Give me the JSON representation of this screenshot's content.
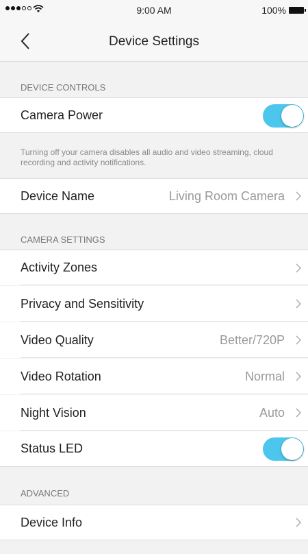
{
  "status_bar": {
    "time": "9:00 AM",
    "battery_text": "100%"
  },
  "nav": {
    "title": "Device Settings",
    "back_icon": "chevron-left-icon"
  },
  "sections": {
    "device_controls": {
      "header": "DEVICE CONTROLS",
      "camera_power": {
        "label": "Camera Power",
        "on": true
      },
      "note": "Turning off your camera disables all audio and video streaming, cloud recording and activity notifications.",
      "device_name": {
        "label": "Device Name",
        "value": "Living Room Camera"
      }
    },
    "camera_settings": {
      "header": "CAMERA SETTINGS",
      "activity_zones": {
        "label": "Activity Zones"
      },
      "privacy": {
        "label": "Privacy and Sensitivity"
      },
      "video_quality": {
        "label": "Video Quality",
        "value": "Better/720P"
      },
      "video_rotation": {
        "label": "Video Rotation",
        "value": "Normal"
      },
      "night_vision": {
        "label": "Night Vision",
        "value": "Auto"
      },
      "status_led": {
        "label": "Status LED",
        "on": true
      }
    },
    "advanced": {
      "header": "ADVANCED",
      "device_info": {
        "label": "Device Info"
      }
    }
  },
  "colors": {
    "toggle_on": "#4cc6ec",
    "background": "#f2f2f2",
    "secondary_text": "#9a9a9a"
  }
}
